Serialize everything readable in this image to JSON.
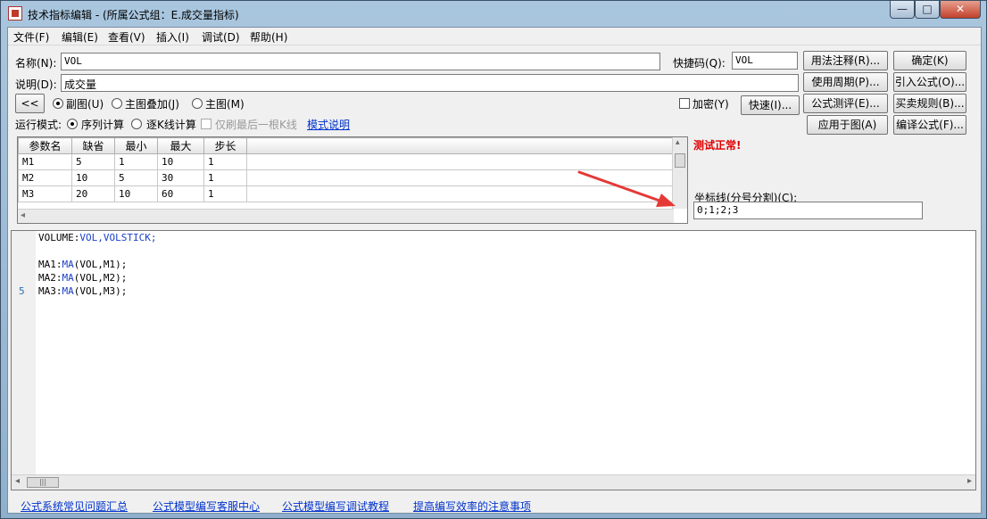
{
  "window": {
    "title": "技术指标编辑 - (所属公式组：E.成交量指标)"
  },
  "menu": [
    "文件(F)",
    "编辑(E)",
    "查看(V)",
    "插入(I)",
    "调试(D)",
    "帮助(H)"
  ],
  "form": {
    "name_label": "名称(N):",
    "name_value": "VOL",
    "hotkey_label": "快捷码(Q):",
    "hotkey_value": "VOL",
    "desc_label": "说明(D):",
    "desc_value": "成交量",
    "collapse_button": "<<",
    "chart_radios": [
      "副图(U)",
      "主图叠加(J)",
      "主图(M)"
    ],
    "encrypt_label": "加密(Y)",
    "fast_button": "快速(I)...",
    "run_mode_label": "运行模式:",
    "run_radios": [
      "序列计算",
      "逐K线计算"
    ],
    "last_k_label": "仅刷最后一根K线",
    "mode_help_link": "模式说明"
  },
  "buttons": [
    "用法注释(R)...",
    "确定(K)",
    "使用周期(P)...",
    "引入公式(O)...",
    "公式测评(E)...",
    "买卖规则(B)...",
    "应用于图(A)",
    "编译公式(F)..."
  ],
  "params": {
    "headers": [
      "参数名",
      "缺省",
      "最小",
      "最大",
      "步长"
    ],
    "rows": [
      [
        "M1",
        "5",
        "1",
        "10",
        "1"
      ],
      [
        "M2",
        "10",
        "5",
        "30",
        "1"
      ],
      [
        "M3",
        "20",
        "10",
        "60",
        "1"
      ]
    ]
  },
  "status": "测试正常!",
  "axis": {
    "label": "坐标线(分号分割)(C):",
    "value": "0;1;2;3"
  },
  "code": {
    "line1_name": "VOLUME:",
    "line1_rest": "VOL,VOLSTICK;",
    "ma1_name": "MA1:",
    "ma2_name": "MA2:",
    "ma3_name": "MA3:",
    "fn": "MA",
    "arg1": "(VOL,M1);",
    "arg2": "(VOL,M2);",
    "arg3": "(VOL,M3);",
    "line_number": "5"
  },
  "footer_links": [
    "公式系统常见问题汇总",
    "公式模型编写客服中心",
    "公式模型编写调试教程",
    "提高编写效率的注意事项"
  ],
  "scroll": {
    "h_grip": "|||"
  },
  "icons": {
    "left_arrow": "◂",
    "right_arrow": "▸",
    "scroll_up": "▴",
    "scroll_down": "▾"
  },
  "colors": {
    "status": "#e00000",
    "arrow": "#e53935",
    "link": "#0033cc",
    "keyword": "#1a3fc7"
  }
}
